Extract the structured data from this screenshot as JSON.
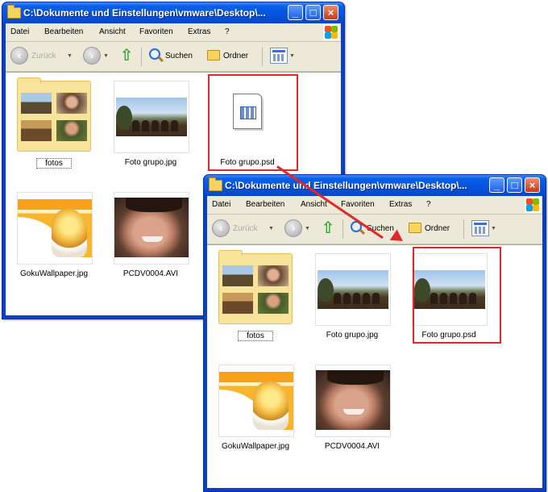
{
  "windows": [
    {
      "title": "C:\\Dokumente und Einstellungen\\vmware\\Desktop\\...",
      "menu": [
        "Datei",
        "Bearbeiten",
        "Ansicht",
        "Favoriten",
        "Extras",
        "?"
      ],
      "toolbar": {
        "back": "Zurück",
        "search": "Suchen",
        "folders": "Ordner"
      },
      "items": [
        "fotos",
        "Foto grupo.jpg",
        "Foto grupo.psd",
        "GokuWallpaper.jpg",
        "PCDV0004.AVI"
      ]
    },
    {
      "title": "C:\\Dokumente und Einstellungen\\vmware\\Desktop\\...",
      "menu": [
        "Datei",
        "Bearbeiten",
        "Ansicht",
        "Favoriten",
        "Extras",
        "?"
      ],
      "toolbar": {
        "back": "Zurück",
        "search": "Suchen",
        "folders": "Ordner"
      },
      "items": [
        "fotos",
        "Foto grupo.jpg",
        "Foto grupo.psd",
        "GokuWallpaper.jpg",
        "PCDV0004.AVI"
      ]
    }
  ],
  "icons": {
    "folder": "folder-icon",
    "up": "folder-up-icon",
    "search": "search-icon",
    "views": "views-icon",
    "psd": "psd-file-icon",
    "minimize": "minimize-icon",
    "maximize": "maximize-icon",
    "close": "close-icon"
  },
  "colors": {
    "titlebar": "#0653df",
    "highlight": "#e0282a",
    "folder": "#f6d45f"
  }
}
